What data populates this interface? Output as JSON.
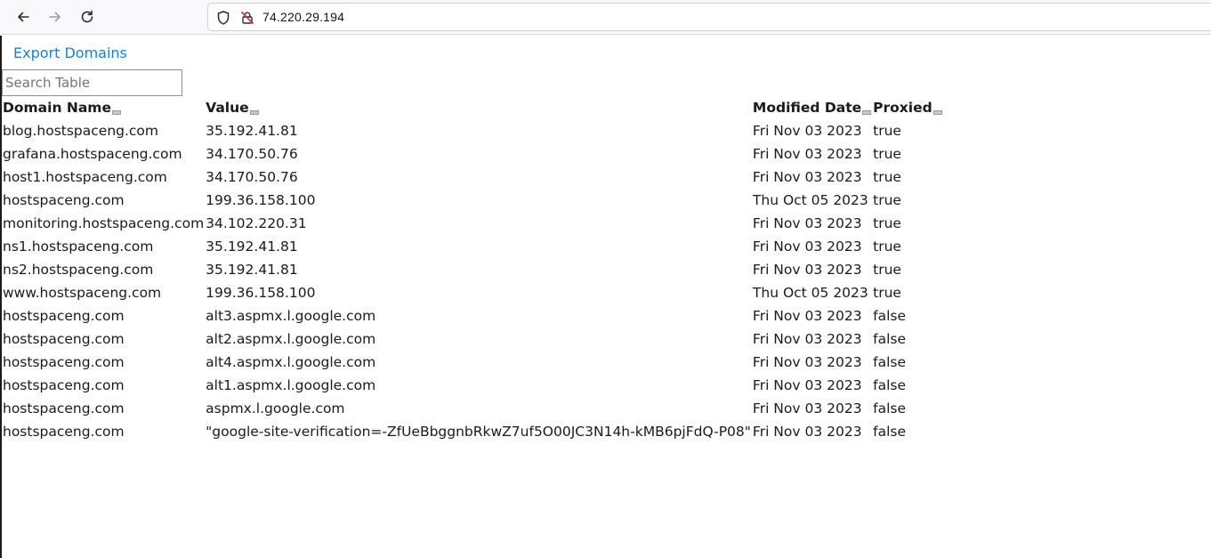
{
  "browser": {
    "url": "74.220.29.194",
    "icons": [
      "back-arrow-icon",
      "forward-arrow-icon",
      "reload-icon",
      "shield-icon",
      "insecure-connection-icon"
    ]
  },
  "page": {
    "export_label": "Export Domains",
    "search_placeholder": "Search Table",
    "search_value": "",
    "columns": [
      "Domain Name",
      "Value",
      "Modified Date",
      "Proxied"
    ],
    "rows": [
      [
        "blog.hostspaceng.com",
        "35.192.41.81",
        "Fri Nov 03 2023",
        "true"
      ],
      [
        "grafana.hostspaceng.com",
        "34.170.50.76",
        "Fri Nov 03 2023",
        "true"
      ],
      [
        "host1.hostspaceng.com",
        "34.170.50.76",
        "Fri Nov 03 2023",
        "true"
      ],
      [
        "hostspaceng.com",
        "199.36.158.100",
        "Thu Oct 05 2023",
        "true"
      ],
      [
        "monitoring.hostspaceng.com",
        "34.102.220.31",
        "Fri Nov 03 2023",
        "true"
      ],
      [
        "ns1.hostspaceng.com",
        "35.192.41.81",
        "Fri Nov 03 2023",
        "true"
      ],
      [
        "ns2.hostspaceng.com",
        "35.192.41.81",
        "Fri Nov 03 2023",
        "true"
      ],
      [
        "www.hostspaceng.com",
        "199.36.158.100",
        "Thu Oct 05 2023",
        "true"
      ],
      [
        "hostspaceng.com",
        "alt3.aspmx.l.google.com",
        "Fri Nov 03 2023",
        "false"
      ],
      [
        "hostspaceng.com",
        "alt2.aspmx.l.google.com",
        "Fri Nov 03 2023",
        "false"
      ],
      [
        "hostspaceng.com",
        "alt4.aspmx.l.google.com",
        "Fri Nov 03 2023",
        "false"
      ],
      [
        "hostspaceng.com",
        "alt1.aspmx.l.google.com",
        "Fri Nov 03 2023",
        "false"
      ],
      [
        "hostspaceng.com",
        "aspmx.l.google.com",
        "Fri Nov 03 2023",
        "false"
      ],
      [
        "hostspaceng.com",
        "\"google-site-verification=-ZfUeBbggnbRkwZ7uf5O00JC3N14h-kMB6pjFdQ-P08\"",
        "Fri Nov 03 2023",
        "false"
      ]
    ]
  },
  "colors": {
    "link": "#1a7fd4",
    "toolbar_bg": "#f9f9fb",
    "insecure_icon": "#e22850"
  }
}
